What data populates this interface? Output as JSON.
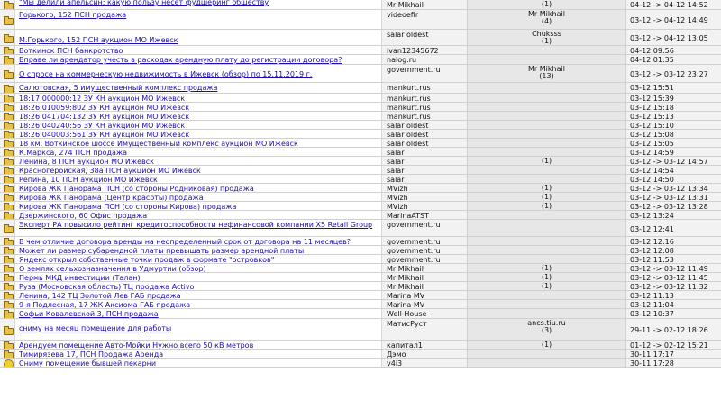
{
  "rows": [
    {
      "icon": "folder",
      "title": "\"Мы делили апельсин: какую пользу несет фудшеринг обществу",
      "author": "Mr Mikhail",
      "replies": "(1)",
      "date": "04-12 -> 04-12 14:52",
      "h": 11,
      "tt": -3
    },
    {
      "icon": "folder",
      "title": "Горького, 152 ПСН продажа",
      "author": "videoefir",
      "replies": "Mr Mikhail\n(4)",
      "date": "03-12 -> 04-12 14:49",
      "h": 22,
      "tt": 0
    },
    {
      "icon": "folder",
      "title": "М.Горького, 152 ПСН аукцион МО Ижевск",
      "author": "salar oldest",
      "replies": "Chuksss\n(1)",
      "date": "03-12 -> 04-12 13:05",
      "h": 18,
      "tt": 6
    },
    {
      "icon": "folder",
      "title": "Воткинск ПСН банкротство",
      "author": "ivan12345672",
      "replies": "",
      "date": "04-12 09:56",
      "h": 10,
      "tt": 0
    },
    {
      "icon": "folder",
      "title": "Вправе ли арендатор учесть в расходах арендную плату до регистрации договора?",
      "author": "nalog.ru",
      "replies": "",
      "date": "04-12 01:35",
      "h": 11,
      "tt": 0
    },
    {
      "icon": "folder",
      "title": "О спросе на коммерческую недвижимость в Ижевск (обзор) по 15.11.2019 г.",
      "author": "government.ru",
      "replies": "Mr Mikhail\n(13)",
      "date": "03-12 -> 03-12 23:27",
      "h": 20,
      "tt": 5
    },
    {
      "icon": "folder",
      "title": "Салютовская, 5 имущественный комплекс продажа",
      "author": "mankurt.rus",
      "replies": "",
      "date": "03-12 15:51",
      "h": 12,
      "tt": 0
    },
    {
      "icon": "folder",
      "title": "18:17:000000:12 ЗУ КН аукцион МО Ижевск",
      "author": "mankurt.rus",
      "replies": "",
      "date": "03-12 15:39",
      "h": 10,
      "tt": 0
    },
    {
      "icon": "folder",
      "title": "18:26:010059:802 ЗУ КН аукцион МО Ижевск",
      "author": "mankurt.rus",
      "replies": "",
      "date": "03-12 15:18",
      "h": 10,
      "tt": 0
    },
    {
      "icon": "folder",
      "title": "18:26:041704:132 ЗУ КН аукцион МО Ижевск",
      "author": "mankurt.rus",
      "replies": "",
      "date": "03-12 15:13",
      "h": 10,
      "tt": 0
    },
    {
      "icon": "folder",
      "title": "18:26:040240:56 ЗУ КН аукцион МО Ижевск",
      "author": "salar oldest",
      "replies": "",
      "date": "03-12 15:10",
      "h": 10,
      "tt": 0
    },
    {
      "icon": "folder",
      "title": "18:26:040003:561 ЗУ КН аукцион МО Ижевск",
      "author": "salar oldest",
      "replies": "",
      "date": "03-12 15:08",
      "h": 10,
      "tt": 0
    },
    {
      "icon": "folder",
      "title": "18 км. Воткинское шоссе Имущественный комплекс аукцион МО Ижевск",
      "author": "salar oldest",
      "replies": "",
      "date": "03-12 15:05",
      "h": 10,
      "tt": 0
    },
    {
      "icon": "folder",
      "title": "К.Маркса, 274 ПСН продажа",
      "author": "salar",
      "replies": "",
      "date": "03-12 14:59",
      "h": 10,
      "tt": 0
    },
    {
      "icon": "folder",
      "title": "Ленина, 8 ПСН аукцион МО Ижевск",
      "author": "salar",
      "replies": "(1)",
      "date": "03-12 -> 03-12 14:57",
      "h": 10,
      "tt": 0
    },
    {
      "icon": "folder",
      "title": "Красногеройская, 38а ПСН аукцион МО Ижевск",
      "author": "salar",
      "replies": "",
      "date": "03-12 14:54",
      "h": 10,
      "tt": 0
    },
    {
      "icon": "folder",
      "title": "Репина, 10 ПСН аукцион МО Ижевск",
      "author": "salar",
      "replies": "",
      "date": "03-12 14:50",
      "h": 10,
      "tt": 0
    },
    {
      "icon": "folder",
      "title": "Кирова ЖК Панорама ПСН (со стороны Родниковая) продажа",
      "author": "MVizh",
      "replies": "(1)",
      "date": "03-12 -> 03-12 13:34",
      "h": 10,
      "tt": 0
    },
    {
      "icon": "folder",
      "title": "Кирова ЖК Панорама (Центр красоты) продажа",
      "author": "MVizh",
      "replies": "(1)",
      "date": "03-12 -> 03-12 13:31",
      "h": 10,
      "tt": 0
    },
    {
      "icon": "folder",
      "title": "Кирова ЖК Панорама ПСН (со стороны Кирова) продажа",
      "author": "MVizh",
      "replies": "(1)",
      "date": "03-12 -> 03-12 13:28",
      "h": 10,
      "tt": 0
    },
    {
      "icon": "folder",
      "title": "Дзержинского, 60 Офис продажа",
      "author": "MarinaATST",
      "replies": "",
      "date": "03-12 13:24",
      "h": 10,
      "tt": 0
    },
    {
      "icon": "folder",
      "title": "Эксперт РА повысило рейтинг кредитоспособности нефинансовой компании X5 Retail Group",
      "author": "government.ru",
      "replies": "",
      "date": "03-12 12:41",
      "h": 19,
      "tt": 0
    },
    {
      "icon": "folder",
      "title": "В чем отличие договора аренды на неопределенный срок от договора на 11 месяцев?",
      "author": "government.ru",
      "replies": "",
      "date": "03-12 12:16",
      "h": 10,
      "tt": 0
    },
    {
      "icon": "folder",
      "title": "Может ли размер субарендной платы превышать размер арендной платы",
      "author": "government.ru",
      "replies": "",
      "date": "03-12 12:08",
      "h": 10,
      "tt": 0
    },
    {
      "icon": "folder",
      "title": "Яндекс открыл собственные точки продаж в формате \"островков\"",
      "author": "government.ru",
      "replies": "",
      "date": "03-12 11:53",
      "h": 10,
      "tt": 0
    },
    {
      "icon": "folder",
      "title": "О землях сельхозназначения в Удмуртии (обзор)",
      "author": "Mr Mikhail",
      "replies": "(1)",
      "date": "03-12 -> 03-12 11:49",
      "h": 10,
      "tt": 0
    },
    {
      "icon": "folder",
      "title": "Пермь МКД инвестиции (Талан)",
      "author": "Mr Mikhail",
      "replies": "(1)",
      "date": "03-12 -> 03-12 11:45",
      "h": 10,
      "tt": 0
    },
    {
      "icon": "folder",
      "title": "Руза (Московская область) ТЦ продажа Activo",
      "author": "Mr Mikhail",
      "replies": "(1)",
      "date": "03-12 -> 03-12 11:32",
      "h": 10,
      "tt": 0
    },
    {
      "icon": "folder",
      "title": "Ленина, 142 ТЦ Золотой Лев ГАБ продажа",
      "author": "Marina MV",
      "replies": "",
      "date": "03-12 11:13",
      "h": 10,
      "tt": 0
    },
    {
      "icon": "folder",
      "title": "9-я Подлесная, 17 ЖК Аксиома ГАБ продажа",
      "author": "Marina MV",
      "replies": "",
      "date": "03-12 11:04",
      "h": 10,
      "tt": 0
    },
    {
      "icon": "folder",
      "title": "Софьи Ковалевской 3, ПСН продажа",
      "author": "Well House",
      "replies": "",
      "date": "03-12 10:37",
      "h": 11,
      "tt": 0
    },
    {
      "icon": "folder",
      "title": "сниму на месяц помещение для работы",
      "author": "МатисРуст",
      "replies": "ancs.tiu.ru\n(3)",
      "date": "29-11 -> 02-12 18:26",
      "h": 24,
      "tt": 5
    },
    {
      "icon": "folder",
      "title": "Арендуем помещение Авто-Мойки Нужно всего 50 кВ метров",
      "author": "капитал1",
      "replies": "(1)",
      "date": "01-12 -> 02-12 15:21",
      "h": 10,
      "tt": 0
    },
    {
      "icon": "folder",
      "title": "Тимирязева 17, ПСН Продажа Аренда",
      "author": "Дэмо",
      "replies": "",
      "date": "30-11 17:17",
      "h": 10,
      "tt": 0
    },
    {
      "icon": "smile",
      "title": "Сниму помещение бывшей пекарни",
      "author": "v4i3",
      "replies": "",
      "date": "30-11 17:28",
      "h": 10,
      "tt": 0
    }
  ]
}
